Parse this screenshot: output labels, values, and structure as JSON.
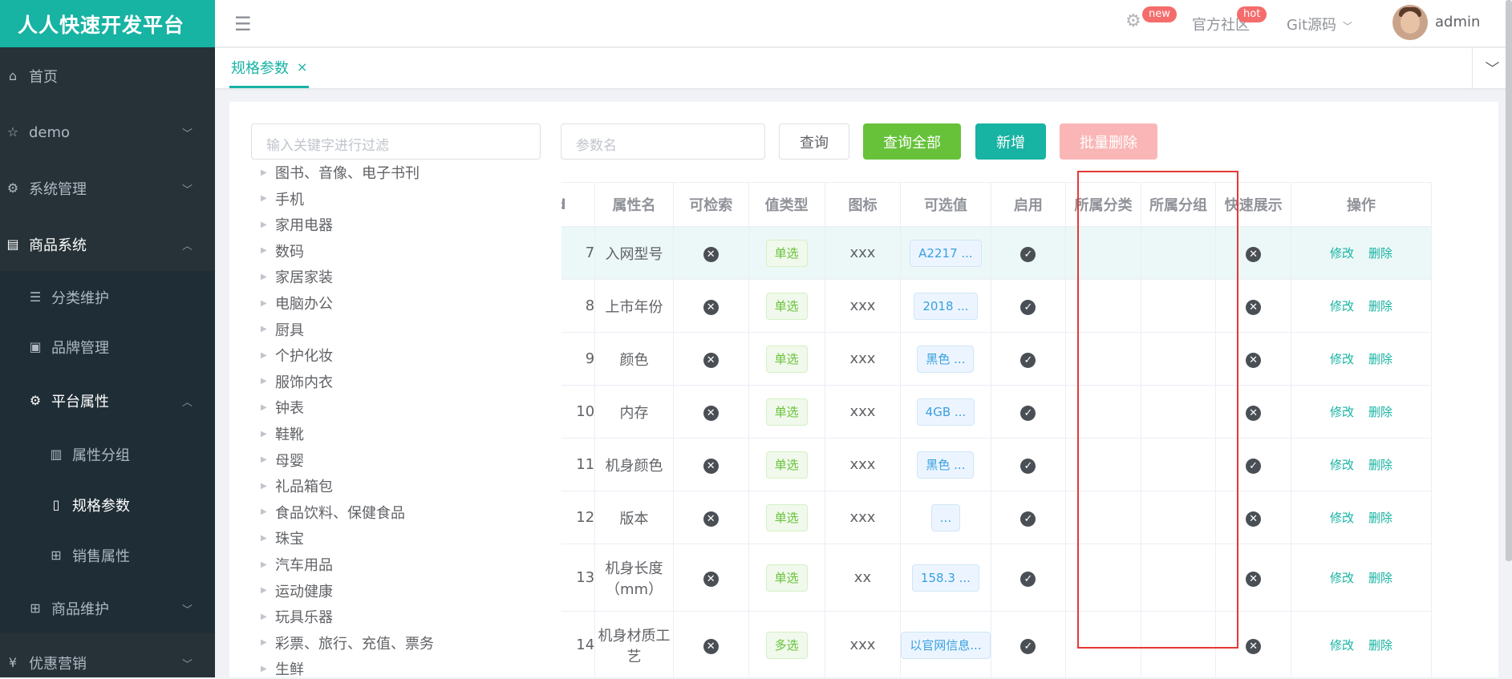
{
  "app": {
    "title": "人人快速开发平台"
  },
  "sidebar": {
    "items": [
      {
        "label": "首页",
        "icon": "home-icon"
      },
      {
        "label": "demo",
        "icon": "star-icon"
      },
      {
        "label": "系统管理",
        "icon": "gear-icon"
      },
      {
        "label": "商品系统",
        "icon": "list-box-icon"
      },
      {
        "label": "分类维护",
        "icon": "list-icon"
      },
      {
        "label": "品牌管理",
        "icon": "id-card-icon"
      },
      {
        "label": "平台属性",
        "icon": "gear-icon"
      },
      {
        "label": "属性分组",
        "icon": "bar-chart-icon"
      },
      {
        "label": "规格参数",
        "icon": "document-icon"
      },
      {
        "label": "销售属性",
        "icon": "grid-icon"
      },
      {
        "label": "商品维护",
        "icon": "grid-icon"
      },
      {
        "label": "优惠营销",
        "icon": "money-icon"
      }
    ]
  },
  "header": {
    "new_badge": "new",
    "community": "官方社区",
    "hot_badge": "hot",
    "git": "Git源码",
    "user": "admin"
  },
  "tabs": [
    {
      "label": "规格参数"
    }
  ],
  "filter": {
    "placeholder": "输入关键字进行过滤"
  },
  "tree": [
    "图书、音像、电子书刊",
    "手机",
    "家用电器",
    "数码",
    "家居家装",
    "电脑办公",
    "厨具",
    "个护化妆",
    "服饰内衣",
    "钟表",
    "鞋靴",
    "母婴",
    "礼品箱包",
    "食品饮料、保健食品",
    "珠宝",
    "汽车用品",
    "运动健康",
    "玩具乐器",
    "彩票、旅行、充值、票务",
    "生鲜"
  ],
  "search": {
    "placeholder": "参数名"
  },
  "buttons": {
    "query": "查询",
    "query_all": "查询全部",
    "add": "新增",
    "batch_delete": "批量删除"
  },
  "colors": {
    "accent": "#17b3a3",
    "success": "#67c23a",
    "danger_light": "#fab6b6",
    "sidebar": "#263238"
  },
  "table": {
    "columns": [
      "id",
      "属性名",
      "可检索",
      "值类型",
      "图标",
      "可选值",
      "启用",
      "所属分类",
      "所属分组",
      "快速展示",
      "操作"
    ],
    "rows": [
      {
        "id": "7",
        "name": "入网型号",
        "searchable": "no",
        "type": "单选",
        "icon": "xxx",
        "values": "A2217 ...",
        "enabled": "yes",
        "category": "",
        "group": "",
        "quick": "no"
      },
      {
        "id": "8",
        "name": "上市年份",
        "searchable": "no",
        "type": "单选",
        "icon": "xxx",
        "values": "2018 ...",
        "enabled": "yes",
        "category": "",
        "group": "",
        "quick": "no"
      },
      {
        "id": "9",
        "name": "颜色",
        "searchable": "no",
        "type": "单选",
        "icon": "xxx",
        "values": "黑色 ...",
        "enabled": "yes",
        "category": "",
        "group": "",
        "quick": "no"
      },
      {
        "id": "10",
        "name": "内存",
        "searchable": "no",
        "type": "单选",
        "icon": "xxx",
        "values": "4GB ...",
        "enabled": "yes",
        "category": "",
        "group": "",
        "quick": "no"
      },
      {
        "id": "11",
        "name": "机身颜色",
        "searchable": "no",
        "type": "单选",
        "icon": "xxx",
        "values": "黑色 ...",
        "enabled": "yes",
        "category": "",
        "group": "",
        "quick": "yes"
      },
      {
        "id": "12",
        "name": "版本",
        "searchable": "no",
        "type": "单选",
        "icon": "xxx",
        "values": "...",
        "enabled": "yes",
        "category": "",
        "group": "",
        "quick": "no"
      },
      {
        "id": "13",
        "name": "机身长度（mm）",
        "searchable": "no",
        "type": "单选",
        "icon": "xx",
        "values": "158.3 ...",
        "enabled": "yes",
        "category": "",
        "group": "",
        "quick": "no"
      },
      {
        "id": "14",
        "name": "机身材质工艺",
        "searchable": "no",
        "type": "多选",
        "icon": "xxx",
        "values": "以官网信息...",
        "enabled": "yes",
        "category": "",
        "group": "",
        "quick": "no"
      }
    ],
    "edit_label": "修改",
    "delete_label": "删除"
  }
}
